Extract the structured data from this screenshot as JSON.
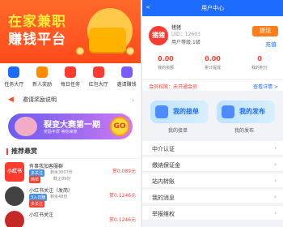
{
  "left": {
    "banner": {
      "t1a": "在家",
      "t1b": "兼职",
      "t2": "赚钱平台"
    },
    "icons": [
      {
        "label": "任务大厅",
        "color": "#1e6bff"
      },
      {
        "label": "新人奖励",
        "color": "#ff8a00"
      },
      {
        "label": "每日任务",
        "color": "#ff3b30"
      },
      {
        "label": "红包大厅",
        "color": "#ff3b30"
      },
      {
        "label": "邀请赚钱",
        "color": "#7b5cff"
      }
    ],
    "notice": "邀请奖励说明",
    "promo": {
      "title": "裂变大赛第一期",
      "sub": "奖励丰厚 等你来拿",
      "go": "GO"
    },
    "section": "推荐悬赏",
    "tasks": [
      {
        "title": "有事我加客服群",
        "tag": "多关注",
        "meta": "剩余3007份",
        "tag2": "简单",
        "meta2": "截止89份",
        "price": "赏0.089元",
        "thumb": "小红书",
        "thumbColor": "#ff3b30"
      },
      {
        "title": "小红书关注（发简）",
        "tag": "3入日赚",
        "meta": "剩余48份",
        "tag2": "多关注",
        "meta2": "",
        "price": "赏0.1246元",
        "thumb": "",
        "thumbColor": "#333"
      },
      {
        "title": "小红书关注",
        "tag": "",
        "meta": "",
        "tag2": "",
        "meta2": "",
        "price": "赏0.1246元",
        "thumb": "",
        "thumbColor": "#c62828"
      }
    ]
  },
  "right": {
    "topbar": {
      "title": "用户中心",
      "back": "<"
    },
    "profile": {
      "avatar": "猪猪",
      "name": "猪猪",
      "uid": "UID：12603",
      "level": "用户等级:1级",
      "btn": "提现",
      "btn2": "充值"
    },
    "stats": [
      {
        "value": "0.00",
        "label": "我的余额"
      },
      {
        "value": "0.00",
        "label": "累计提成"
      },
      {
        "value": "0",
        "label": "我的积分"
      }
    ],
    "member": {
      "text": "会员权限：未开通会员",
      "link": "查看详情 >"
    },
    "big": [
      {
        "label": "我的接单"
      },
      {
        "label": "我的发布"
      }
    ],
    "bigLabels": [
      "我的接单",
      "我的发布"
    ],
    "rows": [
      "中介认证",
      "缴纳保证金",
      "站内转账",
      "我的消息",
      "举报维权"
    ]
  }
}
